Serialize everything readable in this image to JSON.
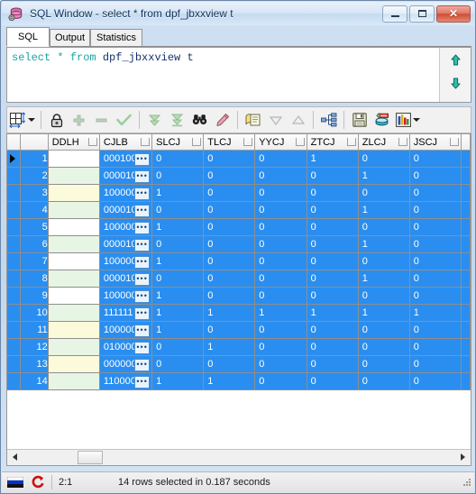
{
  "window": {
    "title": "SQL Window - select * from dpf_jbxxview t",
    "app_icon": "database-gear-icon",
    "buttons": {
      "minimize": "minimize-icon",
      "maximize": "maximize-icon",
      "close": "✕"
    }
  },
  "tabs": [
    {
      "label": "SQL",
      "active": true
    },
    {
      "label": "Output",
      "active": false
    },
    {
      "label": "Statistics",
      "active": false
    }
  ],
  "editor": {
    "tokens": [
      {
        "text": "select",
        "type": "keyword"
      },
      {
        "text": " ",
        "type": "plain"
      },
      {
        "text": "*",
        "type": "keyword"
      },
      {
        "text": " ",
        "type": "plain"
      },
      {
        "text": "from",
        "type": "keyword"
      },
      {
        "text": " ",
        "type": "plain"
      },
      {
        "text": "dpf_jbxxview t",
        "type": "identifier"
      }
    ],
    "full_text": "select * from dpf_jbxxview t",
    "scroll_up_icon": "arrow-up-icon",
    "scroll_down_icon": "arrow-down-icon",
    "keyword_color": "#1aa3a3",
    "identifier_color": "#16336b"
  },
  "toolbar": {
    "items": [
      {
        "name": "grid-layout-button",
        "icon": "grid-resize-icon",
        "enabled": true,
        "dropdown": true
      },
      {
        "name": "lock-button",
        "icon": "padlock-icon",
        "enabled": true,
        "dropdown": false
      },
      {
        "name": "insert-record-button",
        "icon": "plus-icon",
        "enabled": false,
        "dropdown": false
      },
      {
        "name": "delete-record-button",
        "icon": "minus-icon",
        "enabled": false,
        "dropdown": false
      },
      {
        "name": "post-changes-button",
        "icon": "checkmark-icon",
        "enabled": false,
        "dropdown": false
      },
      {
        "name": "fetch-next-button",
        "icon": "double-down-icon",
        "enabled": false,
        "dropdown": false
      },
      {
        "name": "fetch-last-button",
        "icon": "down-to-bar-icon",
        "enabled": false,
        "dropdown": false
      },
      {
        "name": "find-button",
        "icon": "binoculars-icon",
        "enabled": true,
        "dropdown": false
      },
      {
        "name": "highlight-button",
        "icon": "marker-pen-icon",
        "enabled": true,
        "dropdown": false
      },
      {
        "name": "copy-data-button",
        "icon": "copy-pages-icon",
        "enabled": true,
        "dropdown": false
      },
      {
        "name": "sort-desc-button",
        "icon": "triangle-down-icon",
        "enabled": false,
        "dropdown": false
      },
      {
        "name": "sort-asc-button",
        "icon": "triangle-up-icon",
        "enabled": false,
        "dropdown": false
      },
      {
        "name": "structure-button",
        "icon": "hierarchy-icon",
        "enabled": true,
        "dropdown": false
      },
      {
        "name": "save-button",
        "icon": "floppy-disk-icon",
        "enabled": true,
        "dropdown": false
      },
      {
        "name": "export-db-button",
        "icon": "database-export-icon",
        "enabled": true,
        "dropdown": false
      },
      {
        "name": "chart-button",
        "icon": "bar-chart-icon",
        "enabled": true,
        "dropdown": true
      }
    ]
  },
  "grid": {
    "columns": [
      "DDLH",
      "CJLB",
      "SLCJ",
      "TLCJ",
      "YYCJ",
      "ZTCJ",
      "ZLCJ",
      "JSCJ"
    ],
    "selected_color": "#2a8ef0",
    "rows": [
      {
        "n": "1",
        "ddlh": "",
        "ddlh_bg": "#ffffff",
        "cjlb": "000100",
        "slcj": "0",
        "tlcj": "0",
        "yycj": "0",
        "ztcj": "1",
        "zlcj": "0",
        "jscj": "0",
        "current": true
      },
      {
        "n": "2",
        "ddlh": "",
        "ddlh_bg": "#e7f5e4",
        "cjlb": "000010",
        "slcj": "0",
        "tlcj": "0",
        "yycj": "0",
        "ztcj": "0",
        "zlcj": "1",
        "jscj": "0",
        "current": false
      },
      {
        "n": "3",
        "ddlh": "",
        "ddlh_bg": "#fbfada",
        "cjlb": "100000",
        "slcj": "1",
        "tlcj": "0",
        "yycj": "0",
        "ztcj": "0",
        "zlcj": "0",
        "jscj": "0",
        "current": false
      },
      {
        "n": "4",
        "ddlh": "",
        "ddlh_bg": "#e7f5e4",
        "cjlb": "000010",
        "slcj": "0",
        "tlcj": "0",
        "yycj": "0",
        "ztcj": "0",
        "zlcj": "1",
        "jscj": "0",
        "current": false
      },
      {
        "n": "5",
        "ddlh": "",
        "ddlh_bg": "#ffffff",
        "cjlb": "100000",
        "slcj": "1",
        "tlcj": "0",
        "yycj": "0",
        "ztcj": "0",
        "zlcj": "0",
        "jscj": "0",
        "current": false
      },
      {
        "n": "6",
        "ddlh": "",
        "ddlh_bg": "#e7f5e4",
        "cjlb": "000010",
        "slcj": "0",
        "tlcj": "0",
        "yycj": "0",
        "ztcj": "0",
        "zlcj": "1",
        "jscj": "0",
        "current": false
      },
      {
        "n": "7",
        "ddlh": "",
        "ddlh_bg": "#ffffff",
        "cjlb": "100000",
        "slcj": "1",
        "tlcj": "0",
        "yycj": "0",
        "ztcj": "0",
        "zlcj": "0",
        "jscj": "0",
        "current": false
      },
      {
        "n": "8",
        "ddlh": "",
        "ddlh_bg": "#e7f5e4",
        "cjlb": "000010",
        "slcj": "0",
        "tlcj": "0",
        "yycj": "0",
        "ztcj": "0",
        "zlcj": "1",
        "jscj": "0",
        "current": false
      },
      {
        "n": "9",
        "ddlh": "",
        "ddlh_bg": "#ffffff",
        "cjlb": "100000",
        "slcj": "1",
        "tlcj": "0",
        "yycj": "0",
        "ztcj": "0",
        "zlcj": "0",
        "jscj": "0",
        "current": false
      },
      {
        "n": "10",
        "ddlh": "",
        "ddlh_bg": "#e7f5e4",
        "cjlb": "111111",
        "slcj": "1",
        "tlcj": "1",
        "yycj": "1",
        "ztcj": "1",
        "zlcj": "1",
        "jscj": "1",
        "current": false
      },
      {
        "n": "11",
        "ddlh": "",
        "ddlh_bg": "#fbfada",
        "cjlb": "100000",
        "slcj": "1",
        "tlcj": "0",
        "yycj": "0",
        "ztcj": "0",
        "zlcj": "0",
        "jscj": "0",
        "current": false
      },
      {
        "n": "12",
        "ddlh": "",
        "ddlh_bg": "#e7f5e4",
        "cjlb": "010000",
        "slcj": "0",
        "tlcj": "1",
        "yycj": "0",
        "ztcj": "0",
        "zlcj": "0",
        "jscj": "0",
        "current": false
      },
      {
        "n": "13",
        "ddlh": "",
        "ddlh_bg": "#fbfada",
        "cjlb": "000000",
        "slcj": "0",
        "tlcj": "0",
        "yycj": "0",
        "ztcj": "0",
        "zlcj": "0",
        "jscj": "0",
        "current": false
      },
      {
        "n": "14",
        "ddlh": "",
        "ddlh_bg": "#e7f5e4",
        "cjlb": "110000",
        "slcj": "1",
        "tlcj": "1",
        "yycj": "0",
        "ztcj": "0",
        "zlcj": "0",
        "jscj": "0",
        "current": false
      }
    ],
    "ellipsis_label": "•••",
    "hscroll": {
      "left_arrow": "arrow-left-icon",
      "right_arrow": "arrow-right-icon"
    }
  },
  "statusbar": {
    "flag_icon": "flag-icon",
    "refresh_icon": "red-refresh-icon",
    "cursor_position": "2:1",
    "message": "14 rows selected in 0.187 seconds"
  }
}
